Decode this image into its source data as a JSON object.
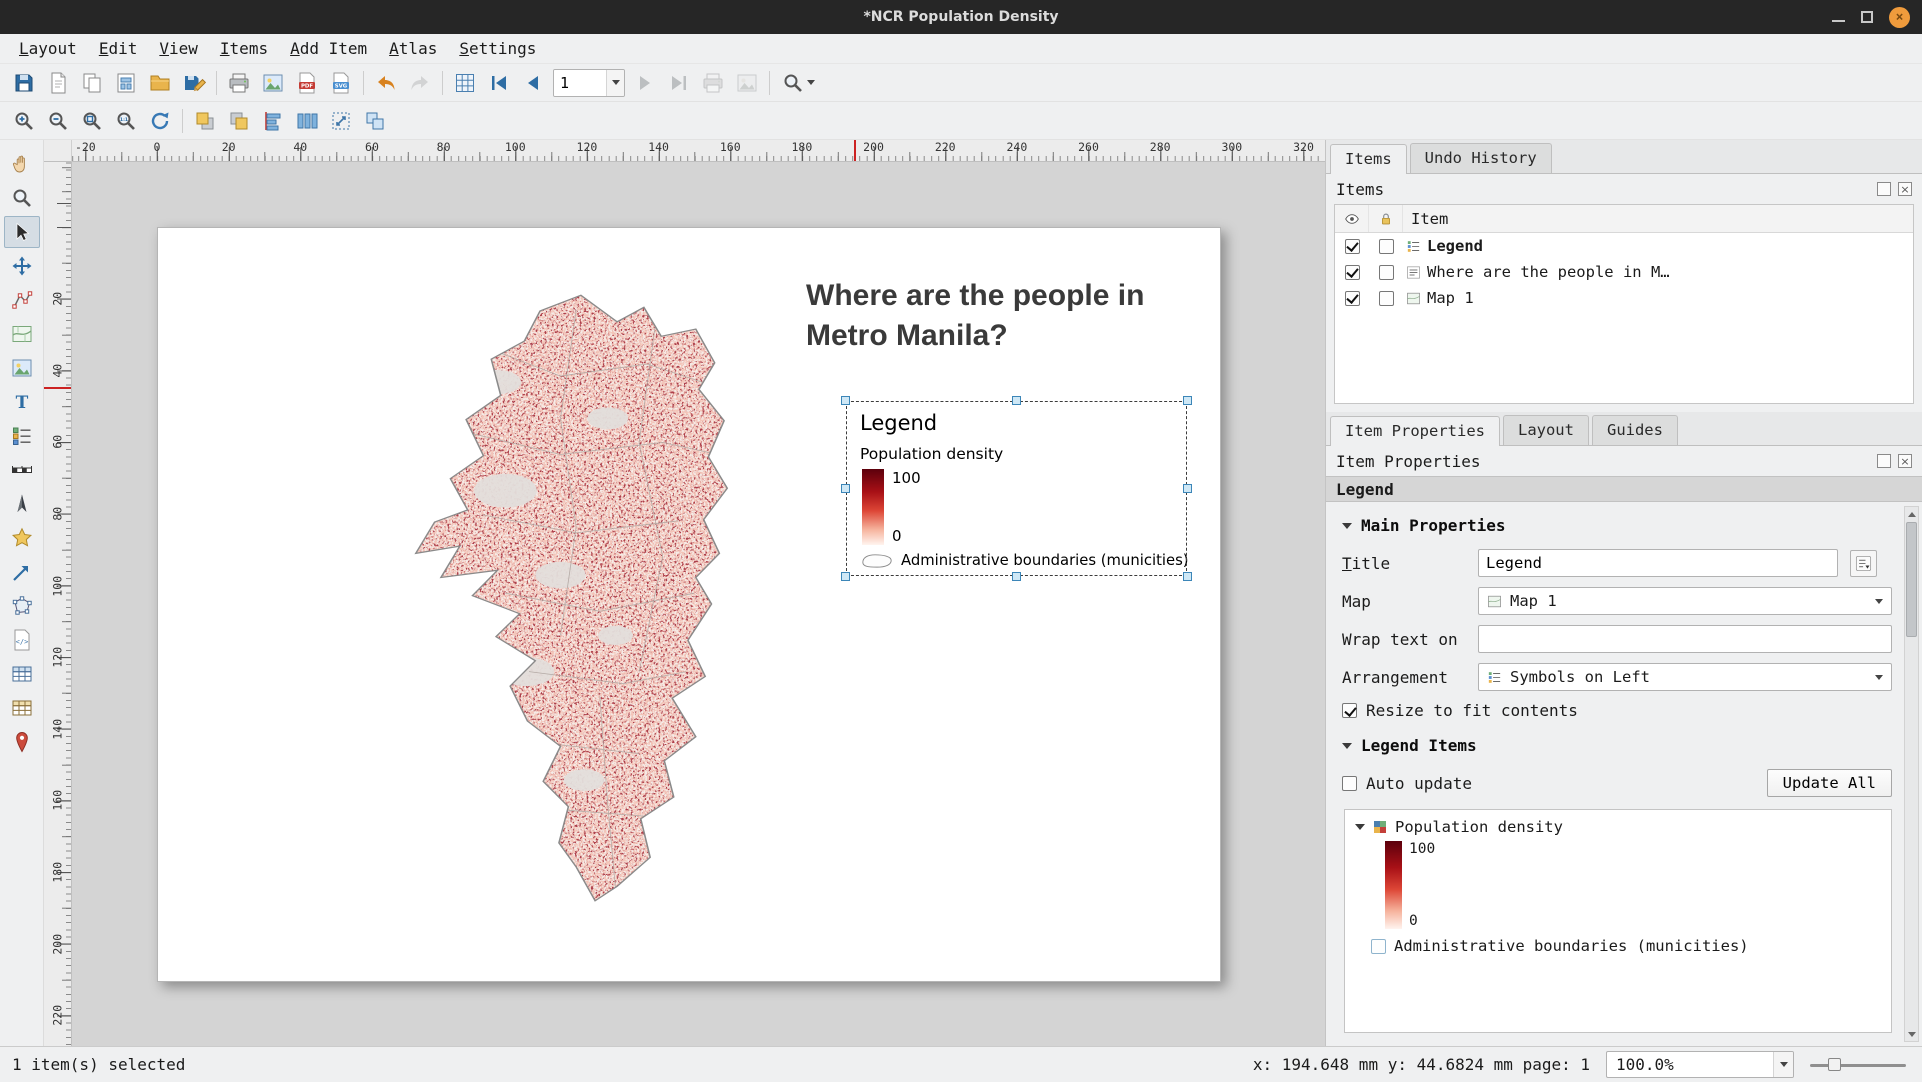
{
  "colors": {
    "close_button": "#ef9b3c",
    "ramp_top": "#5c000c",
    "ramp_bottom": "#fff4ef",
    "ruler_marker": "#cc2222",
    "selection_handle_fill": "#cfe8f6",
    "selection_handle_border": "#3c86b8"
  },
  "window": {
    "title": "*NCR Population Density",
    "close_glyph": "×"
  },
  "menubar": [
    {
      "name": "menu-layout",
      "label": "Layout"
    },
    {
      "name": "menu-edit",
      "label": "Edit"
    },
    {
      "name": "menu-view",
      "label": "View"
    },
    {
      "name": "menu-items",
      "label": "Items"
    },
    {
      "name": "menu-add-item",
      "label": "Add Item"
    },
    {
      "name": "menu-atlas",
      "label": "Atlas"
    },
    {
      "name": "menu-settings",
      "label": "Settings"
    }
  ],
  "toolbars": {
    "page_number_value": "1",
    "group_file": [
      {
        "name": "save-layout-button",
        "icon": "#i-floppy",
        "icon_name": "save-icon"
      },
      {
        "name": "new-layout-button",
        "icon": "#i-page",
        "icon_name": "new-layout-icon"
      },
      {
        "name": "duplicate-layout-button",
        "icon": "#i-pages",
        "icon_name": "duplicate-icon"
      },
      {
        "name": "layout-manager-button",
        "icon": "#i-grid-page",
        "icon_name": "layout-manager-icon"
      },
      {
        "name": "add-items-from-template-button",
        "icon": "#i-folder",
        "icon_name": "folder-icon"
      },
      {
        "name": "save-as-template-button",
        "icon": "#i-floppy-pen",
        "icon_name": "save-template-icon"
      }
    ],
    "group_export": [
      {
        "name": "print-button",
        "icon": "#i-printer",
        "icon_name": "printer-icon"
      },
      {
        "name": "export-image-button",
        "icon": "#i-image",
        "icon_name": "image-icon"
      },
      {
        "name": "export-pdf-button",
        "icon": "#i-pdf",
        "icon_name": "pdf-icon"
      },
      {
        "name": "export-svg-button",
        "icon": "#i-svg",
        "icon_name": "svg-icon"
      }
    ],
    "group_undo": [
      {
        "name": "undo-button",
        "icon": "#i-undo",
        "icon_name": "undo-icon"
      },
      {
        "name": "redo-button",
        "icon": "#i-redo",
        "icon_name": "redo-icon",
        "disabled": true
      }
    ],
    "group_atlas_a": [
      {
        "name": "preview-atlas-button",
        "icon": "#i-atlas",
        "icon_name": "atlas-grid-icon"
      },
      {
        "name": "first-feature-button",
        "icon": "#i-nav-first",
        "icon_name": "first-feature-icon"
      },
      {
        "name": "previous-feature-button",
        "icon": "#i-nav-prev",
        "icon_name": "previous-feature-icon"
      }
    ],
    "group_atlas_b": [
      {
        "name": "next-feature-button",
        "icon": "#i-nav-next",
        "icon_name": "next-feature-icon",
        "disabled": true
      },
      {
        "name": "last-feature-button",
        "icon": "#i-nav-last",
        "icon_name": "last-feature-icon",
        "disabled": true
      },
      {
        "name": "print-atlas-button",
        "icon": "#i-printer",
        "icon_name": "printer-icon",
        "disabled": true
      },
      {
        "name": "export-atlas-button",
        "icon": "#i-image",
        "icon_name": "image-icon",
        "disabled": true
      }
    ],
    "group_zoom": [
      {
        "name": "zoom-in-button",
        "icon": "#i-zoom-in",
        "icon_name": "zoom-in-icon"
      },
      {
        "name": "zoom-out-button",
        "icon": "#i-zoom-out",
        "icon_name": "zoom-out-icon"
      },
      {
        "name": "zoom-full-button",
        "icon": "#i-zoom-full",
        "icon_name": "zoom-full-icon"
      },
      {
        "name": "zoom-actual-button",
        "icon": "#i-zoom-100",
        "icon_name": "zoom-actual-icon"
      },
      {
        "name": "refresh-view-button",
        "icon": "#i-refresh",
        "icon_name": "refresh-icon"
      }
    ],
    "group_arrange": [
      {
        "name": "raise-items-button",
        "icon": "#i-raise",
        "icon_name": "raise-items-icon"
      },
      {
        "name": "lower-items-button",
        "icon": "#i-lower",
        "icon_name": "lower-items-icon"
      },
      {
        "name": "align-items-button",
        "icon": "#i-align",
        "icon_name": "align-items-icon"
      },
      {
        "name": "distribute-items-button",
        "icon": "#i-distribute",
        "icon_name": "distribute-items-icon"
      },
      {
        "name": "resize-items-button",
        "icon": "#i-resize",
        "icon_name": "resize-items-icon"
      },
      {
        "name": "group-items-button",
        "icon": "#i-group",
        "icon_name": "group-items-icon"
      }
    ]
  },
  "tools": [
    {
      "name": "pan-tool",
      "icon": "#i-hand",
      "icon_name": "hand-icon"
    },
    {
      "name": "zoom-tool",
      "icon": "#i-magnifier",
      "icon_name": "magnifier-icon"
    },
    {
      "name": "select-move-item-tool",
      "icon": "#i-cursor",
      "icon_name": "cursor-icon",
      "active": true
    },
    {
      "name": "move-item-content-tool",
      "icon": "#i-move",
      "icon_name": "move-arrows-icon"
    },
    {
      "name": "edit-nodes-item-tool",
      "icon": "#i-nodes",
      "icon_name": "edit-nodes-icon"
    },
    {
      "name": "add-map-tool",
      "icon": "#i-map",
      "icon_name": "map-icon"
    },
    {
      "name": "add-picture-tool",
      "icon": "#i-image",
      "icon_name": "picture-icon"
    },
    {
      "name": "add-label-tool",
      "icon": "#i-label",
      "icon_name": "label-icon"
    },
    {
      "name": "add-legend-tool",
      "icon": "#i-legendlist",
      "icon_name": "legend-icon"
    },
    {
      "name": "add-scalebar-tool",
      "icon": "#i-scalebar",
      "icon_name": "scalebar-icon"
    },
    {
      "name": "add-north-arrow-tool",
      "icon": "#i-north",
      "icon_name": "north-arrow-icon"
    },
    {
      "name": "add-shape-tool",
      "icon": "#i-star",
      "icon_name": "star-shape-icon"
    },
    {
      "name": "add-arrow-tool",
      "icon": "#i-arrow-d",
      "icon_name": "arrow-icon"
    },
    {
      "name": "add-node-item-tool",
      "icon": "#i-nodeitem",
      "icon_name": "node-polygon-icon"
    },
    {
      "name": "add-html-tool",
      "icon": "#i-html",
      "icon_name": "html-icon"
    },
    {
      "name": "add-attribute-table-tool",
      "icon": "#i-table",
      "icon_name": "attribute-table-icon"
    },
    {
      "name": "add-fixed-table-tool",
      "icon": "#i-table2",
      "icon_name": "fixed-table-icon"
    },
    {
      "name": "add-marker-tool",
      "icon": "#i-pin",
      "icon_name": "marker-pin-icon"
    }
  ],
  "rulers": {
    "horizontal": [
      "-20",
      "0",
      "20",
      "40",
      "60",
      "80",
      "100",
      "120",
      "140",
      "160",
      "180",
      "200",
      "220",
      "240",
      "260",
      "280",
      "300",
      "320"
    ],
    "vertical": [
      "20",
      "40",
      "60",
      "80",
      "100",
      "120",
      "140",
      "160",
      "180",
      "200",
      "220"
    ]
  },
  "page": {
    "title": "Where are the people in Metro Manila?",
    "legend": {
      "title": "Legend",
      "layer": "Population density",
      "max": "100",
      "min": "0",
      "boundaries": "Administrative boundaries (municities)"
    }
  },
  "panels": {
    "items": {
      "tabs": [
        {
          "name": "tab-items",
          "label": "Items",
          "active": true
        },
        {
          "name": "tab-undo-history",
          "label": "Undo History"
        }
      ],
      "caption": "Items",
      "columns": {
        "item": "Item"
      },
      "rows": [
        {
          "name": "items-row-legend",
          "label": "Legend",
          "icon": "#i-legenditem",
          "icon_name": "legend-item-icon",
          "bold": true
        },
        {
          "name": "items-row-label",
          "label": "Where are the people in M…",
          "icon": "#i-labelitem",
          "icon_name": "label-item-icon"
        },
        {
          "name": "items-row-map",
          "label": "Map 1",
          "icon": "#i-mapitem",
          "icon_name": "map-item-icon"
        }
      ]
    },
    "properties": {
      "tabs": [
        {
          "name": "tab-item-properties",
          "label": "Item Properties",
          "active": true
        },
        {
          "name": "tab-layout",
          "label": "Layout"
        },
        {
          "name": "tab-guides",
          "label": "Guides"
        }
      ],
      "caption": "Item Properties",
      "item_header": "Legend",
      "main": {
        "heading": "Main Properties",
        "title_label": "Title",
        "title_value": "Legend",
        "map_label": "Map",
        "map_value": "Map 1",
        "wrap_label": "Wrap text on",
        "wrap_value": "",
        "arrangement_label": "Arrangement",
        "arrangement_value": "Symbols on Left",
        "resize_label": "Resize to fit contents"
      },
      "legend_items": {
        "heading": "Legend Items",
        "auto_update_label": "Auto update",
        "update_all_label": "Update All",
        "tree": {
          "layer": "Population density",
          "max": "100",
          "min": "0",
          "boundaries": "Administrative boundaries (municities)"
        }
      }
    }
  },
  "statusbar": {
    "selection": "1 item(s) selected",
    "coordinates": "x: 194.648 mm y: 44.6824 mm page: 1",
    "zoom": "100.0%"
  }
}
